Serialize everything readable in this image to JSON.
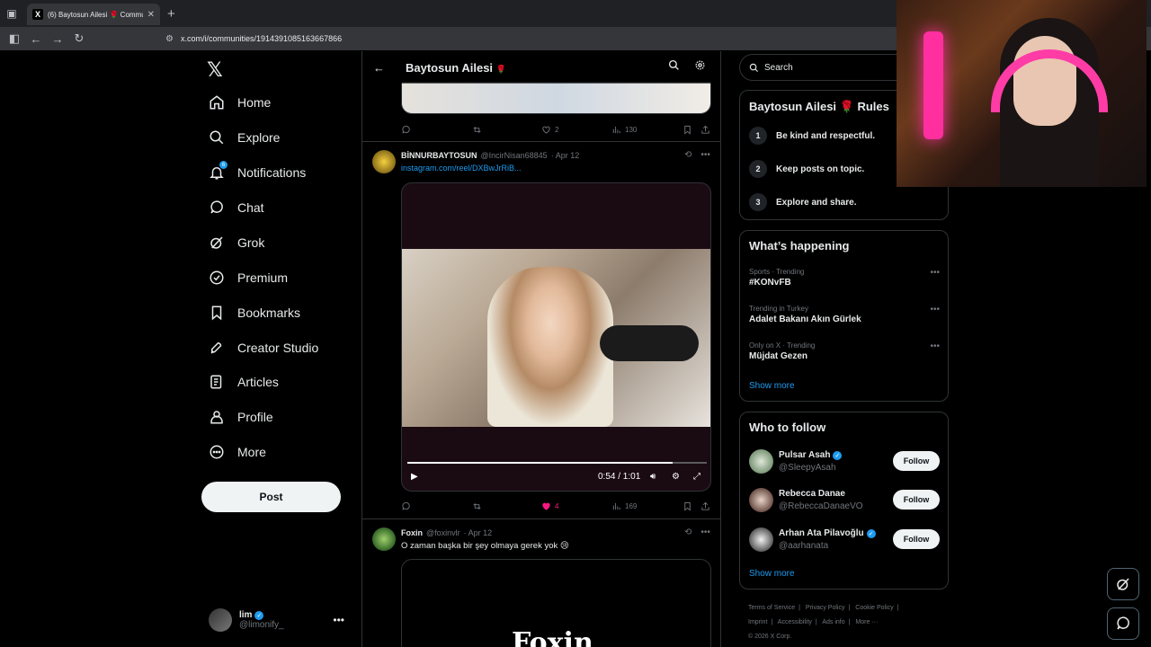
{
  "browser": {
    "tab_title": "(6) Baytosun Ailesi 🌹 Commun",
    "url": "x.com/i/communities/1914391085163667866"
  },
  "nav": {
    "items": [
      {
        "label": "Home",
        "icon": "home-icon"
      },
      {
        "label": "Explore",
        "icon": "search-icon"
      },
      {
        "label": "Notifications",
        "icon": "bell-icon",
        "badge": "6"
      },
      {
        "label": "Chat",
        "icon": "chat-icon"
      },
      {
        "label": "Grok",
        "icon": "grok-icon"
      },
      {
        "label": "Premium",
        "icon": "premium-icon"
      },
      {
        "label": "Bookmarks",
        "icon": "bookmark-icon"
      },
      {
        "label": "Creator Studio",
        "icon": "rocket-icon"
      },
      {
        "label": "Articles",
        "icon": "articles-icon"
      },
      {
        "label": "Profile",
        "icon": "person-icon"
      },
      {
        "label": "More",
        "icon": "more-circle-icon"
      }
    ],
    "post_label": "Post",
    "account": {
      "name": "lim",
      "handle": "@limonify_"
    }
  },
  "timeline": {
    "title": "Baytosun Ailesi",
    "title_emoji": "🌹",
    "prev_tweet": {
      "likes": "2",
      "views": "130"
    },
    "tweet1": {
      "name": "BİNNURBAYTOSUN",
      "handle": "@IncirNisan68845",
      "date": "· Apr 12",
      "link": "instagram.com/reel/DXBwJrRiB...",
      "video_time": "0:54 / 1:01",
      "video_progress": 0.885,
      "likes": "4",
      "views": "169"
    },
    "tweet2": {
      "name": "Foxin",
      "handle": "@foxinvlr",
      "date": "· Apr 12",
      "text": "O zaman başka bir şey olmaya gerek yok 😢",
      "media_text": "Foxin"
    }
  },
  "right": {
    "search_placeholder": "Search",
    "rules": {
      "title": "Baytosun Ailesi 🌹 Rules",
      "items": [
        {
          "num": "1",
          "text": "Be kind and respectful."
        },
        {
          "num": "2",
          "text": "Keep posts on topic."
        },
        {
          "num": "3",
          "text": "Explore and share."
        }
      ]
    },
    "happening": {
      "title": "What’s happening",
      "trends": [
        {
          "cat": "Sports · Trending",
          "name": "#KONvFB"
        },
        {
          "cat": "Trending in Turkey",
          "name": "Adalet Bakanı Akın Gürlek"
        },
        {
          "cat": "Only on X · Trending",
          "name": "Müjdat Gezen"
        }
      ],
      "show_more": "Show more"
    },
    "who_to_follow": {
      "title": "Who to follow",
      "users": [
        {
          "name": "Pulsar Asah",
          "handle": "@SleepyAsah",
          "verified": true
        },
        {
          "name": "Rebecca Danae",
          "handle": "@RebeccaDanaeVO",
          "verified": false
        },
        {
          "name": "Arhan Ata Pilavoğlu",
          "handle": "@aarhanata",
          "verified": true
        }
      ],
      "follow_label": "Follow",
      "show_more": "Show more"
    },
    "footer": {
      "links": [
        "Terms of Service",
        "|",
        "Privacy Policy",
        "|",
        "Cookie Policy",
        "|",
        "Imprint",
        "|",
        "Accessibility",
        "|",
        "Ads info",
        "|",
        "More ···"
      ],
      "copyright": "© 2026 X Corp."
    }
  }
}
